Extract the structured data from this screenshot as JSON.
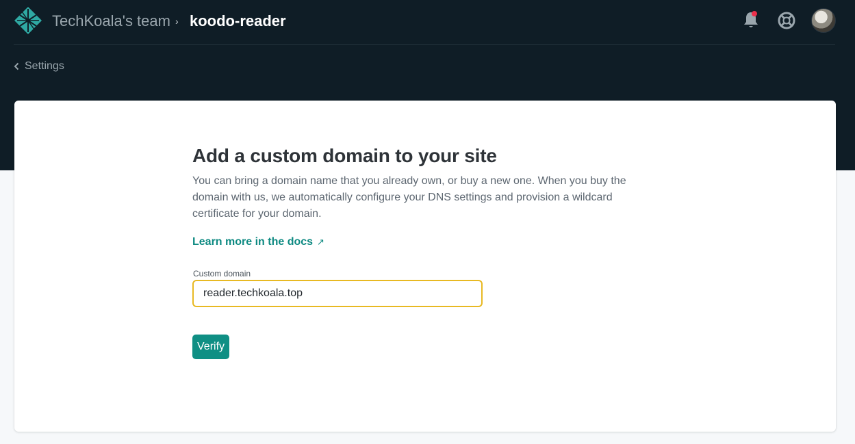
{
  "header": {
    "team_name": "TechKoala's team",
    "breadcrumb_separator": "›",
    "site_name": "koodo-reader",
    "icons": {
      "logo": "netlify-logo-icon",
      "notifications": "bell-icon",
      "help": "lifebuoy-icon",
      "avatar": "user-avatar"
    },
    "notification_dot_color": "#ec2f4b"
  },
  "nav": {
    "back_label": "Settings"
  },
  "form": {
    "title": "Add a custom domain to your site",
    "description": "You can bring a domain name that you already own, or buy a new one. When you buy the domain with us, we automatically configure your DNS settings and provision a wildcard certificate for your domain.",
    "docs_link_label": "Learn more in the docs",
    "docs_link_arrow": "↗",
    "domain_label": "Custom domain",
    "domain_value": "reader.techkoala.top",
    "verify_label": "Verify"
  },
  "colors": {
    "header_bg": "#0f1d26",
    "accent": "#0f8f84",
    "input_focus_border": "#e8b923"
  }
}
